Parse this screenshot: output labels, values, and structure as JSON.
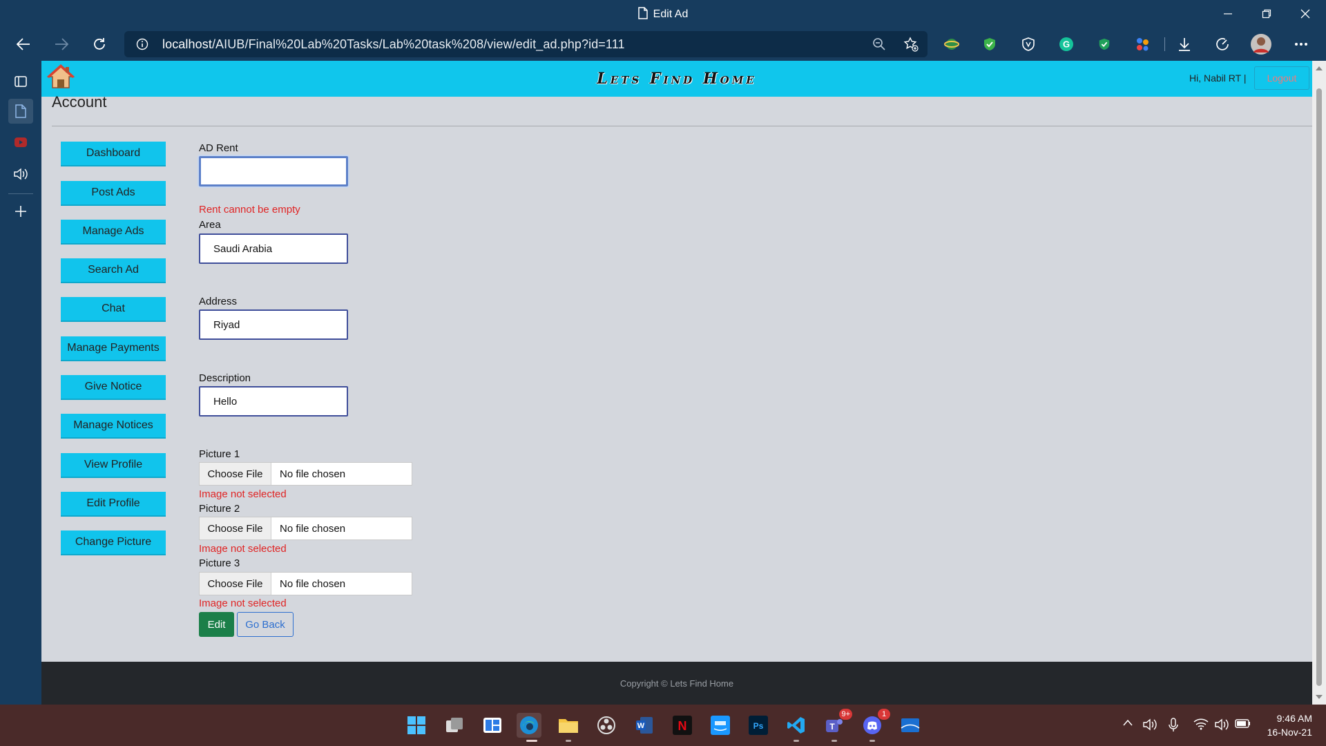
{
  "window": {
    "title": "Edit Ad"
  },
  "browser": {
    "url_host": "localhost",
    "url_path": "/AIUB/Final%20Lab%20Tasks/Lab%20task%208/view/edit_ad.php?id=111"
  },
  "site": {
    "brand": "Lets Find Home",
    "greeting": "Hi, Nabil RT |",
    "logout_label": "Logout"
  },
  "page": {
    "heading": "Account",
    "sidebar": [
      "Dashboard",
      "Post Ads",
      "Manage Ads",
      "Search Ad",
      "Chat",
      "Manage Payments",
      "Give Notice",
      "Manage Notices",
      "View Profile",
      "Edit Profile",
      "Change Picture"
    ],
    "form": {
      "rent_label": "AD Rent",
      "rent_value": "",
      "rent_error": "Rent cannot be empty",
      "area_label": "Area",
      "area_value": "Saudi Arabia",
      "address_label": "Address",
      "address_value": "Riyad",
      "description_label": "Description",
      "description_value": "Hello",
      "pictures": [
        {
          "label": "Picture 1",
          "choose": "Choose File",
          "status": "No file chosen",
          "error": "Image not selected"
        },
        {
          "label": "Picture 2",
          "choose": "Choose File",
          "status": "No file chosen",
          "error": "Image not selected"
        },
        {
          "label": "Picture 3",
          "choose": "Choose File",
          "status": "No file chosen",
          "error": "Image not selected"
        }
      ],
      "edit_label": "Edit",
      "back_label": "Go Back"
    },
    "footer": "Copyright © Lets Find Home"
  },
  "taskbar": {
    "time": "9:46 AM",
    "date": "16-Nov-21",
    "teams_badge": "9+",
    "discord_badge": "1"
  },
  "colors": {
    "header": "#10c6ec",
    "sidebar_button": "#11c4ec",
    "error": "#e02424",
    "edit_button": "#1b7f49",
    "footer": "#24272b"
  }
}
